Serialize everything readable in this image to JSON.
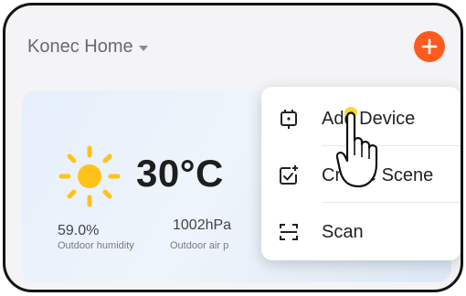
{
  "header": {
    "home_title": "Konec Home",
    "add_button_icon": "plus-icon",
    "accent_color": "#ff5a1f"
  },
  "weather": {
    "temperature": "30°C",
    "condition_icon": "sun-icon",
    "humidity_value": "59.0%",
    "humidity_label": "Outdoor humidity",
    "pressure_value": "1002hPa",
    "pressure_label": "Outdoor air p"
  },
  "menu": {
    "items": [
      {
        "label": "Add Device",
        "icon": "add-device-icon"
      },
      {
        "label": "Create Scene",
        "icon": "create-scene-icon"
      },
      {
        "label": "Scan",
        "icon": "scan-icon"
      }
    ]
  },
  "overlay": {
    "pointer_icon": "hand-pointer-icon"
  }
}
